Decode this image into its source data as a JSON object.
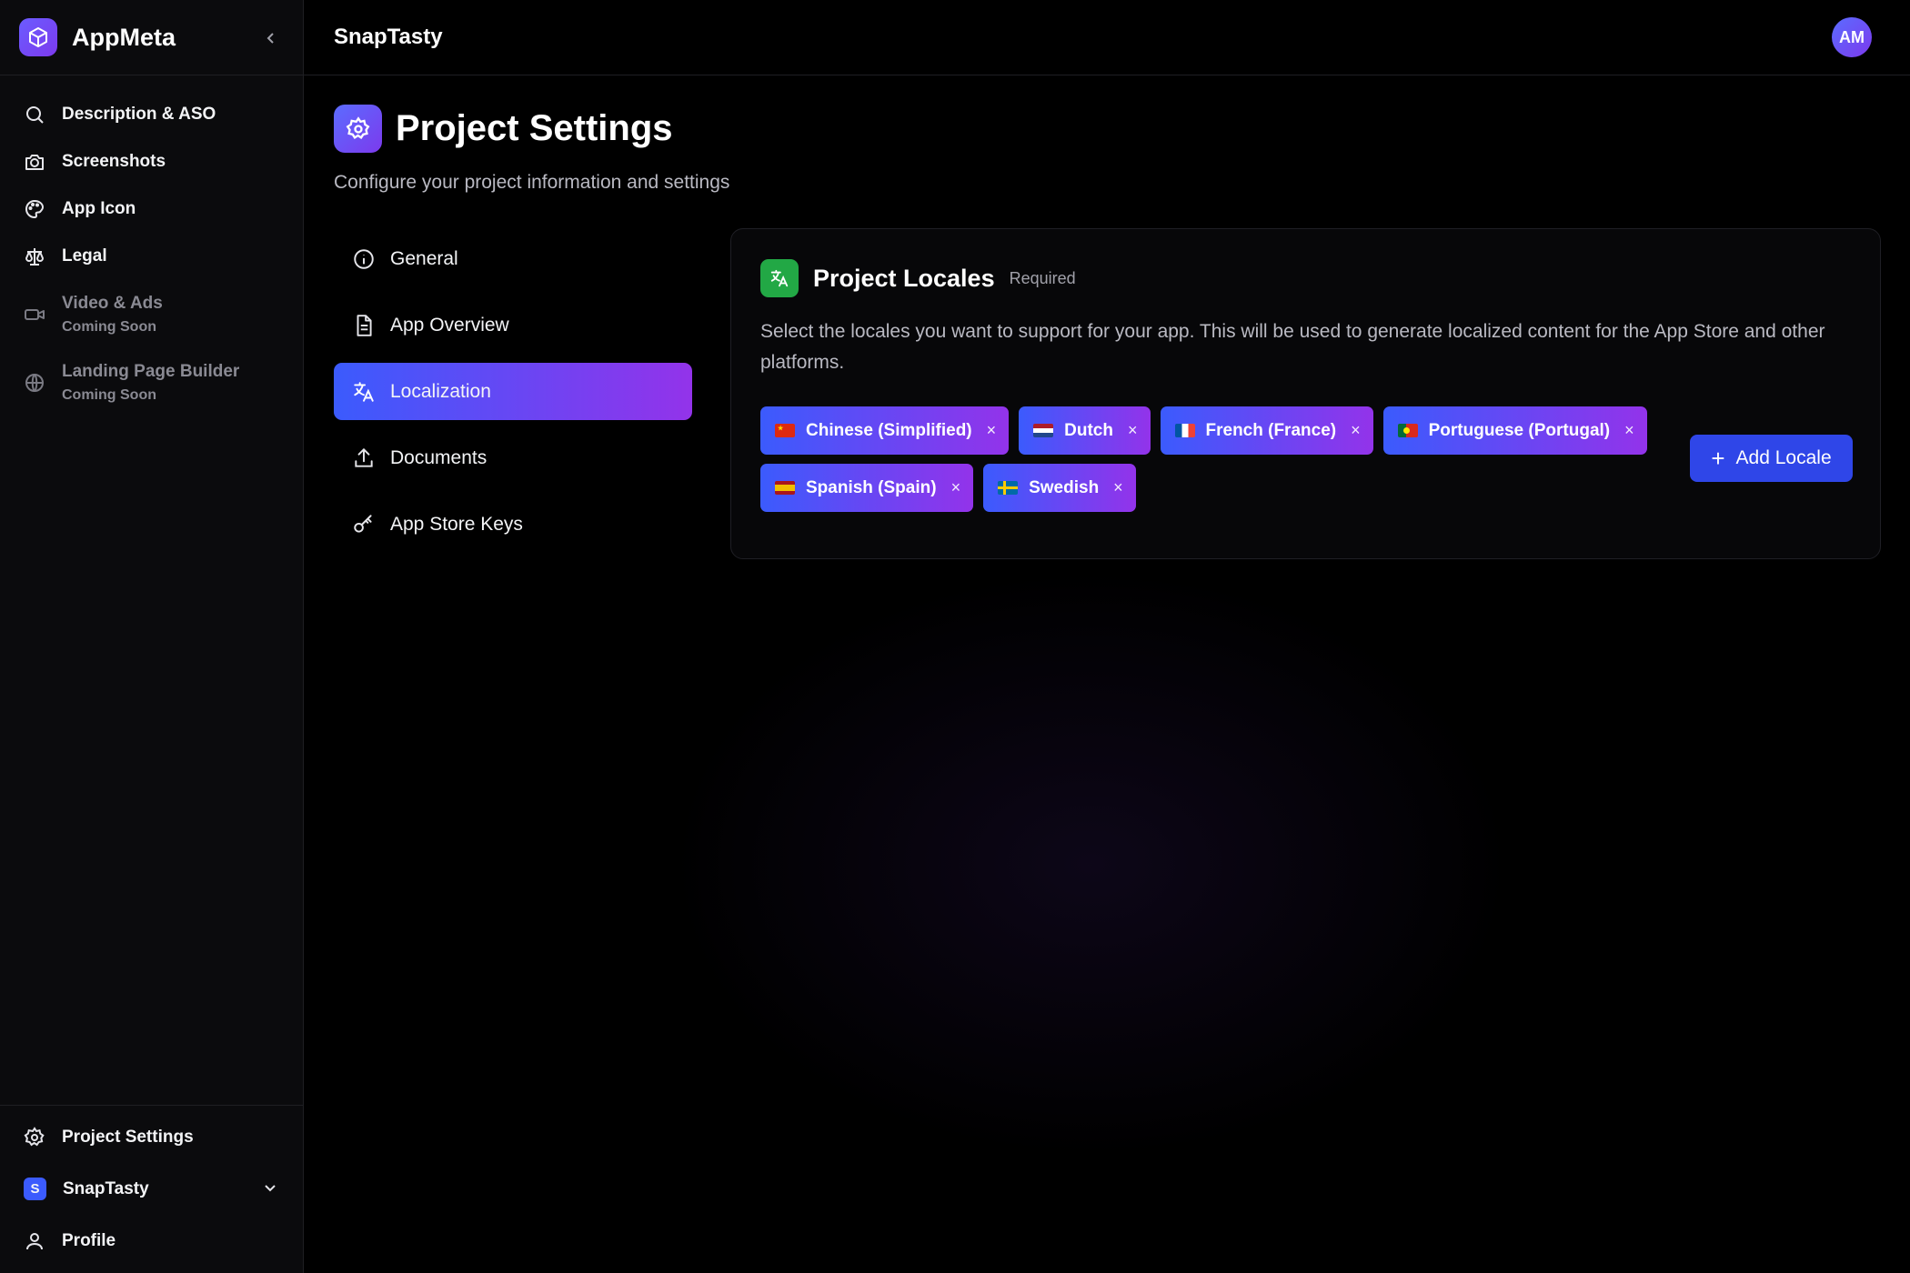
{
  "app": {
    "name": "AppMeta"
  },
  "sidebar": {
    "items": [
      {
        "label": "Description & ASO",
        "icon": "search-icon"
      },
      {
        "label": "Screenshots",
        "icon": "camera-icon"
      },
      {
        "label": "App Icon",
        "icon": "palette-icon"
      },
      {
        "label": "Legal",
        "icon": "scale-icon"
      },
      {
        "label": "Video & Ads",
        "sub": "Coming Soon",
        "icon": "video-icon"
      },
      {
        "label": "Landing Page Builder",
        "sub": "Coming Soon",
        "icon": "globe-icon"
      }
    ],
    "bottom": {
      "settings": "Project Settings",
      "project": "SnapTasty",
      "project_badge": "S",
      "profile": "Profile"
    }
  },
  "header": {
    "project": "SnapTasty",
    "avatar": "AM"
  },
  "page": {
    "title": "Project Settings",
    "subtitle": "Configure your project information and settings"
  },
  "tabs": [
    {
      "label": "General",
      "icon": "info-icon"
    },
    {
      "label": "App Overview",
      "icon": "document-icon"
    },
    {
      "label": "Localization",
      "icon": "translate-icon",
      "active": true
    },
    {
      "label": "Documents",
      "icon": "upload-icon"
    },
    {
      "label": "App Store Keys",
      "icon": "key-icon"
    }
  ],
  "locales_card": {
    "title": "Project Locales",
    "badge": "Required",
    "description": "Select the locales you want to support for your app. This will be used to generate localized content for the App Store and other platforms.",
    "locales": [
      "Chinese (Simplified)",
      "Dutch",
      "French (France)",
      "Portuguese (Portugal)",
      "Spanish (Spain)",
      "Swedish"
    ],
    "remove_glyph": "×",
    "add_button": "Add Locale",
    "add_glyph": "+"
  },
  "colors": {
    "accent_start": "#3b5bfd",
    "accent_end": "#9333ea",
    "green": "#22a845"
  }
}
